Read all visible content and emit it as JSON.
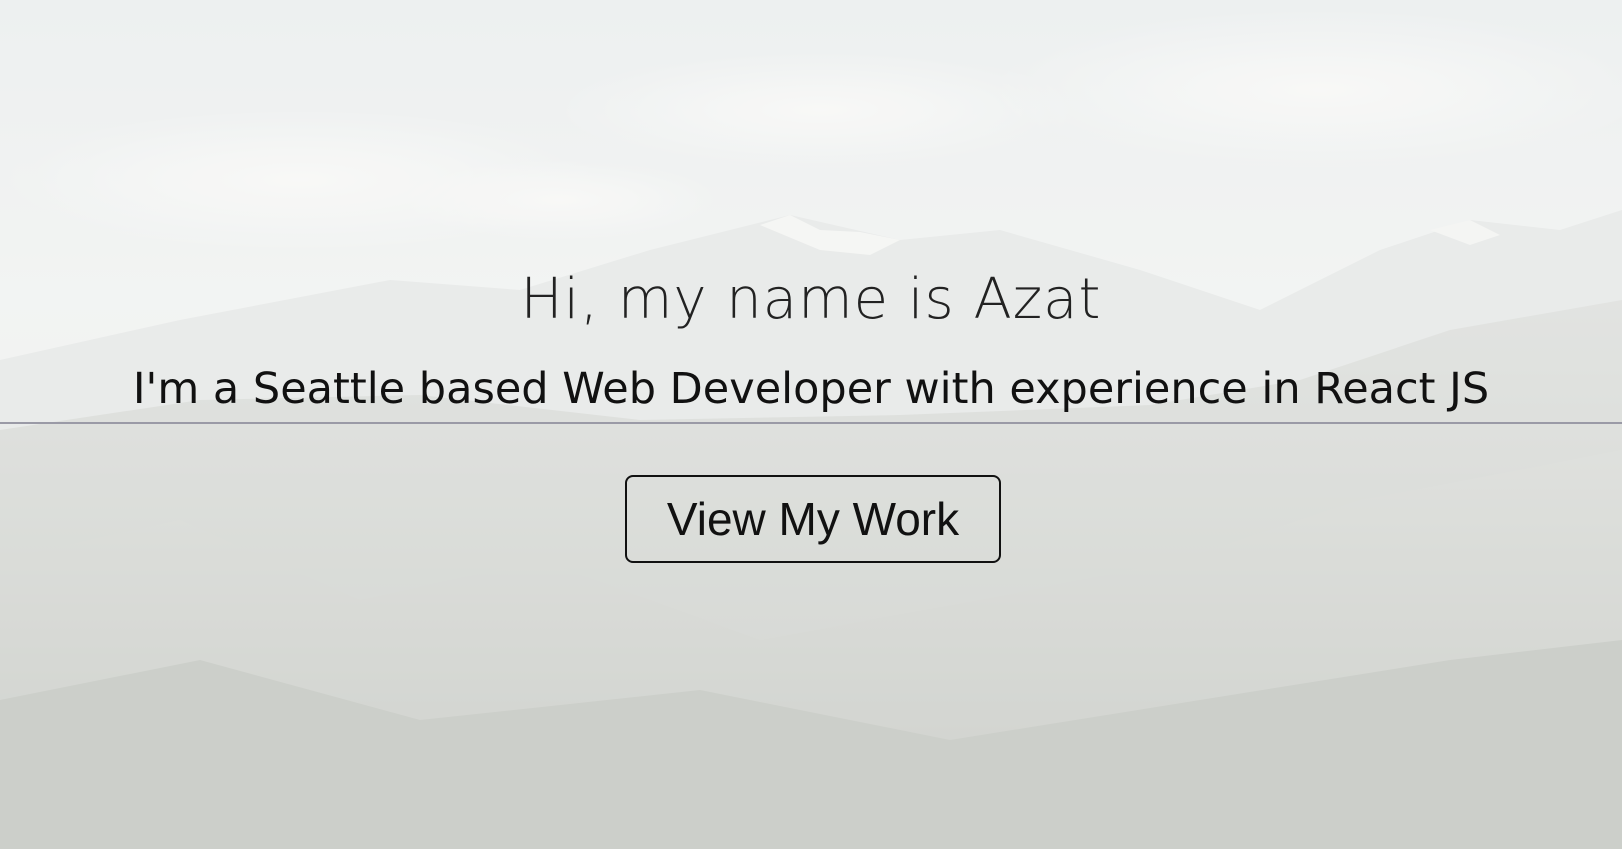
{
  "hero": {
    "greeting": "Hi, my name is Azat",
    "tagline": "I'm a Seattle based Web Developer with experience in React JS",
    "cta_label": "View My Work",
    "background": "misty mountain forest landscape"
  },
  "colors": {
    "text": "#111111",
    "divider": "#9a9aa6",
    "button_border": "#111111"
  }
}
